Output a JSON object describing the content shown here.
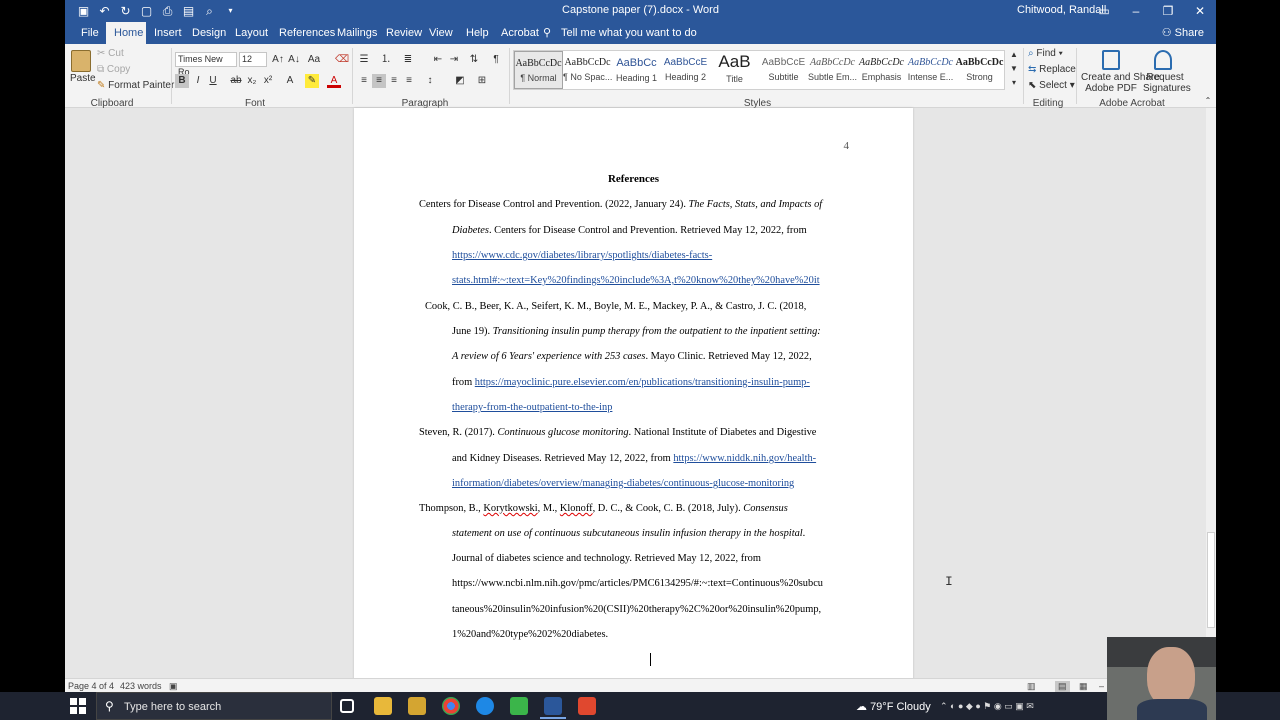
{
  "titlebar": {
    "doc_title": "Capstone paper (7).docx - Word",
    "user": "Chitwood, Randall"
  },
  "tabs": [
    {
      "label": "File"
    },
    {
      "label": "Home"
    },
    {
      "label": "Insert"
    },
    {
      "label": "Design"
    },
    {
      "label": "Layout"
    },
    {
      "label": "References"
    },
    {
      "label": "Mailings"
    },
    {
      "label": "Review"
    },
    {
      "label": "View"
    },
    {
      "label": "Help"
    },
    {
      "label": "Acrobat"
    },
    {
      "label": "Tell me what you want to do"
    }
  ],
  "share": "Share",
  "ribbon": {
    "clipboard": {
      "paste": "Paste",
      "cut": "Cut",
      "copy": "Copy",
      "format_painter": "Format Painter",
      "label": "Clipboard"
    },
    "font": {
      "name": "Times New Ro",
      "size": "12",
      "label": "Font"
    },
    "paragraph": {
      "label": "Paragraph"
    },
    "styles": {
      "label": "Styles",
      "items": [
        {
          "preview": "AaBbCcDc",
          "name": "¶ Normal"
        },
        {
          "preview": "AaBbCcDc",
          "name": "¶ No Spac..."
        },
        {
          "preview": "AaBbCc",
          "name": "Heading 1"
        },
        {
          "preview": "AaBbCcE",
          "name": "Heading 2"
        },
        {
          "preview": "AaB",
          "name": "Title"
        },
        {
          "preview": "AaBbCcE",
          "name": "Subtitle"
        },
        {
          "preview": "AaBbCcDc",
          "name": "Subtle Em..."
        },
        {
          "preview": "AaBbCcDc",
          "name": "Emphasis"
        },
        {
          "preview": "AaBbCcDc",
          "name": "Intense E..."
        },
        {
          "preview": "AaBbCcDc",
          "name": "Strong"
        }
      ]
    },
    "editing": {
      "find": "Find",
      "replace": "Replace",
      "select": "Select",
      "label": "Editing"
    },
    "acrobat": {
      "create_share": "Create and Share",
      "adobe_pdf": "Adobe PDF",
      "request": "Request",
      "signatures": "Signatures",
      "label": "Adobe Acrobat"
    }
  },
  "document": {
    "page_number": "4",
    "heading": "References",
    "ref1": {
      "l1a": "Centers for Disease Control and Prevention. (2022, January 24). ",
      "l1b": "The Facts, Stats, and Impacts of",
      "l2a": "Diabetes",
      "l2b": ". Centers for Disease Control and Prevention. Retrieved May 12, 2022, from",
      "l3": "https://www.cdc.gov/diabetes/library/spotlights/diabetes-facts-",
      "l4": "stats.html#:~:text=Key%20findings%20include%3A,t%20know%20they%20have%20it"
    },
    "ref2": {
      "l1": "Cook, C. B., Beer, K. A., Seifert, K. M., Boyle, M. E., Mackey, P. A., & Castro, J. C. (2018,",
      "l2a": "June 19). ",
      "l2b": "Transitioning insulin pump therapy from the outpatient to the inpatient setting:",
      "l3a": "A review of 6 Years' experience with 253 cases",
      "l3b": ". Mayo Clinic. Retrieved May 12, 2022,",
      "l4a": "from ",
      "l4b": "https://mayoclinic.pure.elsevier.com/en/publications/transitioning-insulin-pump-",
      "l5": "therapy-from-the-outpatient-to-the-inp"
    },
    "ref3": {
      "l1a": "Steven, R. (2017). ",
      "l1b": "Continuous glucose monitoring",
      "l1c": ". National Institute of Diabetes and Digestive",
      "l2a": "and Kidney Diseases. Retrieved May 12, 2022, from ",
      "l2b": "https://www.niddk.nih.gov/health-",
      "l3": "information/diabetes/overview/managing-diabetes/continuous-glucose-monitoring"
    },
    "ref4": {
      "l1a": "Thompson, B., ",
      "l1b": "Korytkowski",
      "l1c": ", M., ",
      "l1d": "Klonoff",
      "l1e": ", D. C., & Cook, C. B. (2018, July). ",
      "l1f": "Consensus",
      "l2": "statement on use of continuous subcutaneous insulin infusion therapy in the hospital",
      "l2b": ".",
      "l3": "Journal of diabetes science and technology. Retrieved May 12, 2022, from",
      "l4": "https://www.ncbi.nlm.nih.gov/pmc/articles/PMC6134295/#:~:text=Continuous%20subcu",
      "l5": "taneous%20insulin%20infusion%20(CSII)%20therapy%2C%20or%20insulin%20pump,",
      "l6": "1%20and%20type%202%20diabetes."
    }
  },
  "statusbar": {
    "page": "Page 4 of 4",
    "words": "423 words"
  },
  "taskbar": {
    "search_placeholder": "Type here to search",
    "weather": "79°F  Cloudy"
  },
  "colors": {
    "word_blue": "#2b579a",
    "link": "#1f4e9c"
  }
}
